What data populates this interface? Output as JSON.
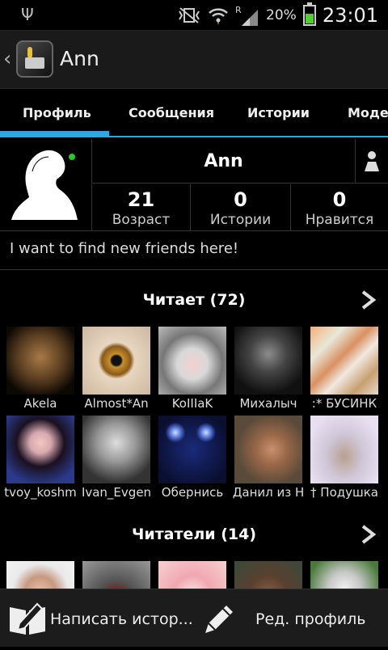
{
  "status_bar": {
    "battery_pct": "20%",
    "time": "23:01",
    "signal_letter": "R"
  },
  "action_bar": {
    "title": "Ann"
  },
  "tabs": [
    {
      "label": "Профиль"
    },
    {
      "label": "Сообщения"
    },
    {
      "label": "Истории"
    },
    {
      "label": "Модер"
    }
  ],
  "profile": {
    "name": "Ann",
    "stats": [
      {
        "value": "21",
        "label": "Возраст"
      },
      {
        "value": "0",
        "label": "Истории"
      },
      {
        "value": "0",
        "label": "Нравится"
      }
    ],
    "status_text": "I want to find new friends here!"
  },
  "following": {
    "title": "Читает (72)",
    "users": [
      {
        "name": "Akela",
        "icon": "wolf-photo"
      },
      {
        "name": "Almost*An",
        "icon": "eye-photo"
      },
      {
        "name": "KoIIIaK",
        "icon": "cat-photo"
      },
      {
        "name": "Михалыч",
        "icon": "knight-photo"
      },
      {
        "name": ":* БУСИНК",
        "icon": "collage-photo"
      },
      {
        "name": "tvoy_koshm",
        "icon": "girl-photo"
      },
      {
        "name": "Ivan_Evgen",
        "icon": "boy-photo"
      },
      {
        "name": "Обернись",
        "icon": "eyes-photo"
      },
      {
        "name": "Данил из Н",
        "icon": "teen-photo"
      },
      {
        "name": "† Подушка",
        "icon": "selfie-photo"
      }
    ]
  },
  "followers": {
    "title": "Читатели (14)",
    "users": [
      {
        "icon": "woman-photo"
      },
      {
        "icon": "rose-photo"
      },
      {
        "icon": "anime-photo"
      },
      {
        "icon": "bear-photo"
      },
      {
        "icon": "dog-photo"
      }
    ]
  },
  "bottom_bar": {
    "write_story_label": "Написать истор...",
    "edit_profile_label": "Ред. профиль"
  }
}
